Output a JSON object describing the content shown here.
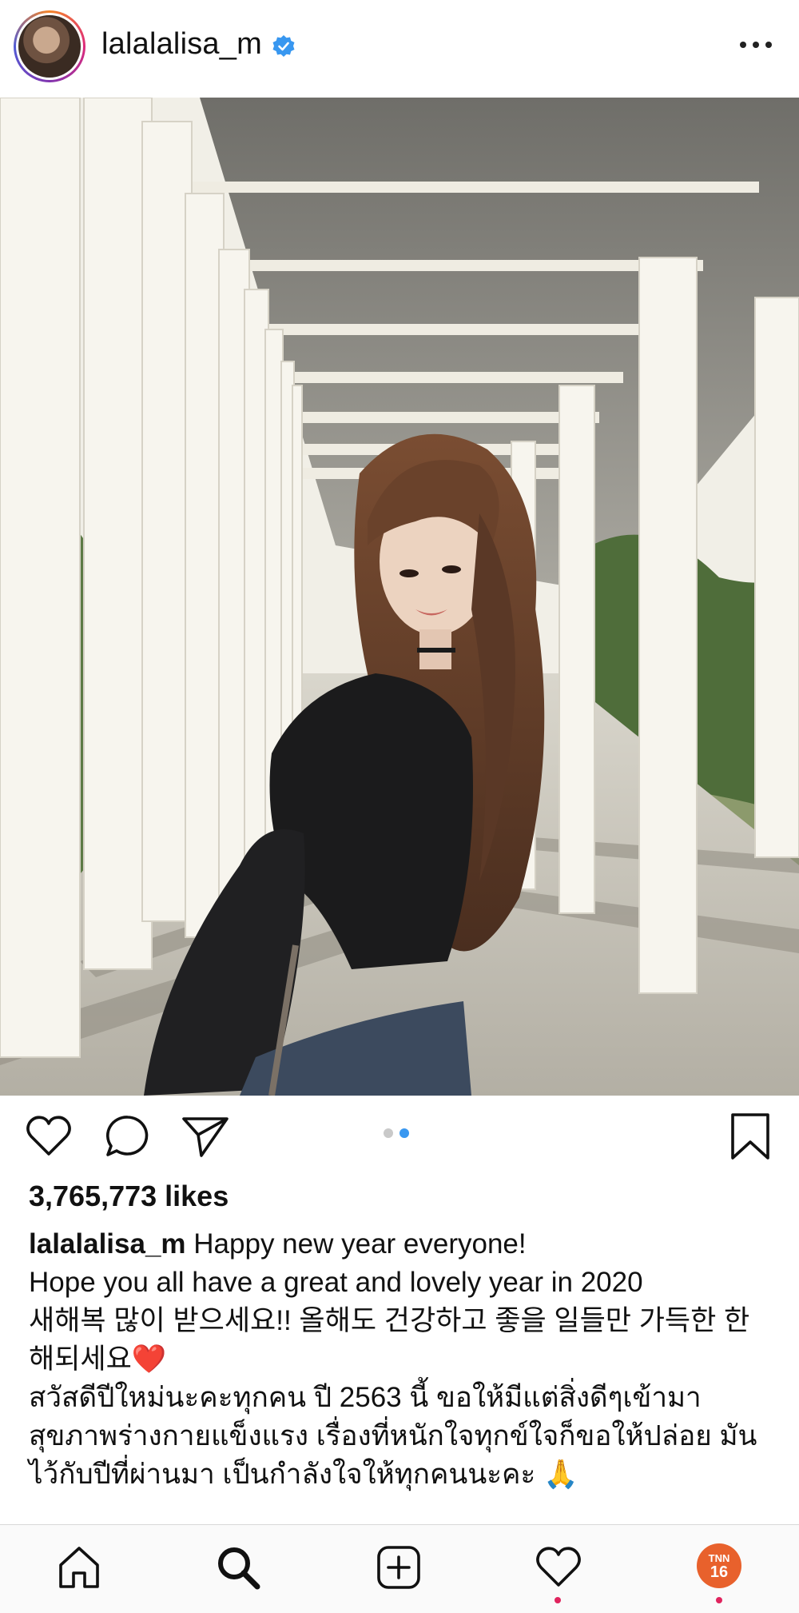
{
  "header": {
    "username": "lalalalisa_m",
    "verified_icon": "verified-badge-icon",
    "more_icon": "more-options-icon"
  },
  "photo": {
    "carousel_count": 2,
    "carousel_active_index": 1
  },
  "actions": {
    "like_icon": "heart-icon",
    "comment_icon": "comment-icon",
    "share_icon": "paper-plane-icon",
    "save_icon": "bookmark-icon"
  },
  "likes_text": "3,765,773 likes",
  "caption": {
    "username": "lalalalisa_m",
    "line1": "Happy new year everyone!",
    "line2": "Hope you all have a great and lovely year in 2020",
    "korean": "새해복 많이 받으세요!! 올해도 건강하고 좋을 일들만 가득한 한 해되세요",
    "korean_emoji": "❤️",
    "thai": "สวัสดีปีใหม่นะคะทุกคน ปี 2563 นี้ ขอให้มีแต่สิ่งดีๆเข้ามา สุขภาพร่างกายแข็งแรง เรื่องที่หนักใจทุกข์ใจก็ขอให้ปล่อย มันไว้กับปีที่ผ่านมา เป็นกำลังใจให้ทุกคนนะคะ",
    "thai_emoji": "🙏"
  },
  "bottom_nav": {
    "items": [
      "home-icon",
      "search-icon",
      "new-post-icon",
      "activity-heart-icon",
      "profile-avatar"
    ],
    "profile_badge_top": "TNN",
    "profile_badge_num": "16"
  },
  "colors": {
    "accent_blue": "#3897f0",
    "notification_red": "#e0245e",
    "badge_orange": "#e8612c"
  }
}
